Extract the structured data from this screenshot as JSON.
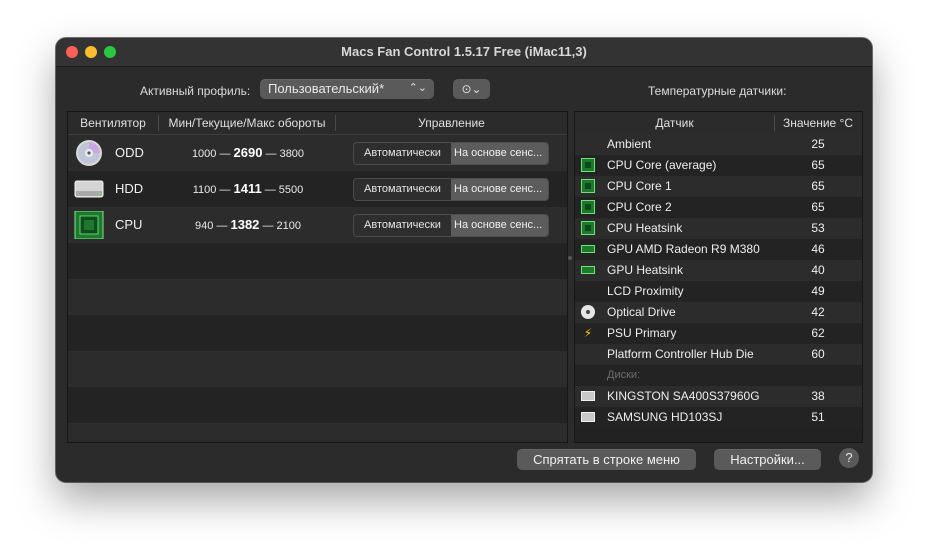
{
  "window": {
    "title": "Macs Fan Control 1.5.17 Free (iMac11,3)"
  },
  "profile": {
    "label": "Активный профиль:",
    "value": "Пользовательский*",
    "more_icon": "ellipsis-circle-icon"
  },
  "sensors_label": "Температурные датчики:",
  "fans_table": {
    "headers": [
      "Вентилятор",
      "Мин/Текущие/Макс обороты",
      "Управление"
    ],
    "rows": [
      {
        "name": "ODD",
        "icon": "optical-disc-icon",
        "min": "1000 —",
        "current": "2690",
        "max": "— 3800",
        "auto_label": "Автоматически",
        "sensor_label": "На основе сенс..."
      },
      {
        "name": "HDD",
        "icon": "hard-drive-icon",
        "min": "1100 —",
        "current": "1411",
        "max": "— 5500",
        "auto_label": "Автоматически",
        "sensor_label": "На основе сенс..."
      },
      {
        "name": "CPU",
        "icon": "cpu-chip-icon",
        "min": "940 —",
        "current": "1382",
        "max": "— 2100",
        "auto_label": "Автоматически",
        "sensor_label": "На основе сенс..."
      }
    ]
  },
  "sensors_table": {
    "headers": [
      "Датчик",
      "Значение °C"
    ],
    "rows": [
      {
        "name": "Ambient",
        "value": "25",
        "icon": ""
      },
      {
        "name": "CPU Core (average)",
        "value": "65",
        "icon": "cpu-chip-icon"
      },
      {
        "name": "CPU Core 1",
        "value": "65",
        "icon": "cpu-chip-icon"
      },
      {
        "name": "CPU Core 2",
        "value": "65",
        "icon": "cpu-chip-icon"
      },
      {
        "name": "CPU Heatsink",
        "value": "53",
        "icon": "cpu-chip-icon"
      },
      {
        "name": "GPU AMD Radeon R9 M380",
        "value": "46",
        "icon": "gpu-card-icon"
      },
      {
        "name": "GPU Heatsink",
        "value": "40",
        "icon": "gpu-card-icon"
      },
      {
        "name": "LCD Proximity",
        "value": "49",
        "icon": ""
      },
      {
        "name": "Optical Drive",
        "value": "42",
        "icon": "optical-disc-icon"
      },
      {
        "name": "PSU Primary",
        "value": "62",
        "icon": "lightning-bolt-icon"
      },
      {
        "name": "Platform Controller Hub Die",
        "value": "60",
        "icon": ""
      }
    ],
    "disks_group_label": "Диски:",
    "disks": [
      {
        "name": "KINGSTON SA400S37960G",
        "value": "38",
        "icon": "ssd-drive-icon"
      },
      {
        "name": "SAMSUNG HD103SJ",
        "value": "51",
        "icon": "hard-drive-icon"
      }
    ]
  },
  "footer": {
    "hide_button": "Спрятать в строке меню",
    "settings_button": "Настройки...",
    "help_button": "?"
  }
}
